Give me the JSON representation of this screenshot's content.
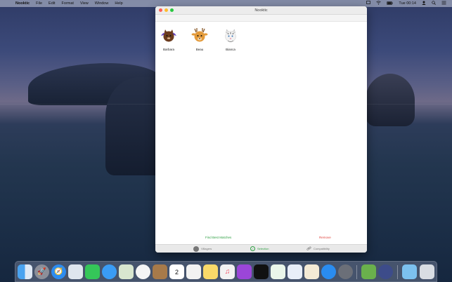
{
  "menubar": {
    "apple_icon": "apple-icon",
    "app_name": "Nooktic",
    "menus": [
      "File",
      "Edit",
      "Format",
      "View",
      "Window",
      "Help"
    ],
    "clock": "Tue 00:14",
    "status_icons": [
      "screen-mirror-icon",
      "wifi-icon",
      "battery-icon",
      "user-icon",
      "spotlight-icon",
      "control-center-icon"
    ]
  },
  "window": {
    "title": "Nooktic",
    "villagers": [
      {
        "name": "Barbara",
        "icon": "cat-villager-icon",
        "color": "#6b3b1e"
      },
      {
        "name": "Beau",
        "icon": "deer-villager-icon",
        "color": "#e39a3a"
      },
      {
        "name": "Bianca",
        "icon": "tiger-villager-icon",
        "color": "#e8e8e8"
      }
    ],
    "actions": {
      "find_label": "Find Best Matches",
      "remove_label": "Remove"
    },
    "tabs": {
      "villagers_label": "Villagers",
      "selection_label": "Selection",
      "compat_label": "Compatibility"
    }
  },
  "dock": {
    "apps": [
      "finder-icon",
      "launchpad-icon",
      "safari-icon",
      "mail-preview-icon",
      "facetime-icon",
      "messages-icon",
      "maps-icon",
      "photos-icon",
      "notes-brown-icon",
      "calendar-icon",
      "reminders-icon",
      "notes-icon",
      "music-icon",
      "podcasts-icon",
      "tv-icon",
      "numbers-icon",
      "keynote-icon",
      "pages-icon",
      "app-store-icon",
      "system-preferences-icon",
      "nooktic-icon",
      "compass-icon",
      "downloads-folder-icon",
      "trash-icon"
    ],
    "calendar_day": "2"
  }
}
